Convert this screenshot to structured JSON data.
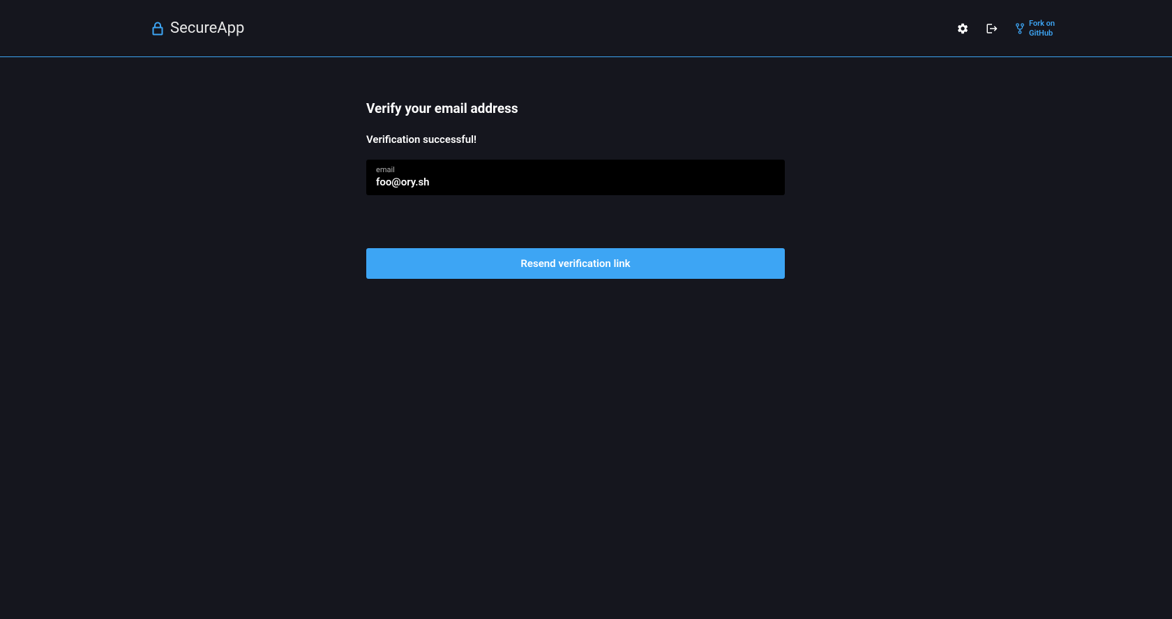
{
  "header": {
    "brand": "SecureApp",
    "fork_label": "Fork on GitHub"
  },
  "main": {
    "title": "Verify your email address",
    "status_message": "Verification successful!",
    "email": {
      "label": "email",
      "value": "foo@ory.sh"
    },
    "button_label": "Resend verification link"
  }
}
